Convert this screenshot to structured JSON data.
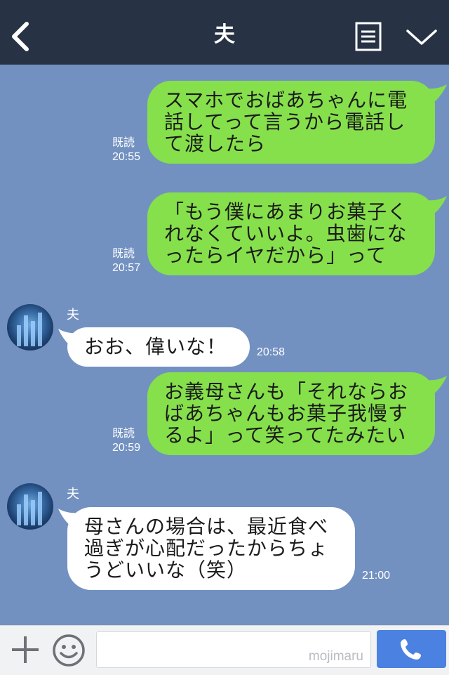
{
  "header": {
    "title": "夫",
    "back_icon": "chevron-left-icon",
    "notes_icon": "notes-icon",
    "menu_icon": "chevron-down-icon",
    "background": "#283245"
  },
  "chat": {
    "background": "#7291c1",
    "messages": [
      {
        "direction": "outgoing",
        "lines": [
          "スマホでおばあちゃんに電",
          "話してって言うから電話し",
          "て渡したら"
        ],
        "read_label": "既読",
        "time": "20:55"
      },
      {
        "direction": "outgoing",
        "lines": [
          "「もう僕にあまりお菓子く",
          "れなくていいよ。虫歯にな",
          "ったらイヤだから」って"
        ],
        "read_label": "既読",
        "time": "20:57"
      },
      {
        "direction": "incoming",
        "sender": "夫",
        "lines": [
          "おお、偉いな！"
        ],
        "time": "20:58"
      },
      {
        "direction": "outgoing",
        "lines": [
          "お義母さんも「それならお",
          "ばあちゃんもお菓子我慢す",
          "るよ」って笑ってたみたい"
        ],
        "read_label": "既読",
        "time": "20:59"
      },
      {
        "direction": "incoming",
        "sender": "夫",
        "lines": [
          "母さんの場合は、最近食べ",
          "過ぎが心配だったからちょ",
          "うどいいな（笑）"
        ],
        "time": "21:00"
      }
    ],
    "outgoing_color": "#86e04b",
    "incoming_color": "#ffffff"
  },
  "input_bar": {
    "plus_icon": "plus-icon",
    "emoji_icon": "smiley-icon",
    "placeholder": "",
    "watermark": "mojimaru",
    "call_icon": "phone-icon",
    "call_color": "#4b81e0"
  }
}
